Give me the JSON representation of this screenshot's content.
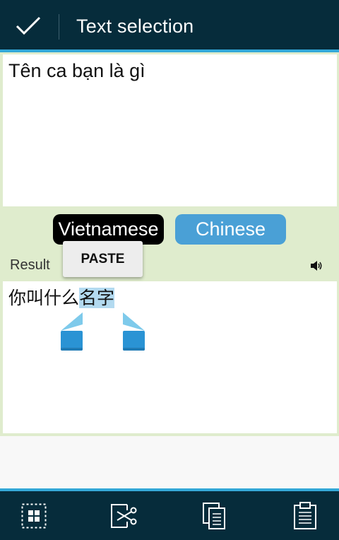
{
  "action_bar": {
    "title": "Text selection",
    "done_icon": "check-icon"
  },
  "input": {
    "text": "Tên ca bạn là gì"
  },
  "languages": {
    "source": "Vietnamese",
    "target": "Chinese"
  },
  "result": {
    "label": "Result",
    "text_plain": "你叫什么",
    "text_selected": "名字",
    "speaker_icon": "speaker-icon"
  },
  "context_popup": {
    "paste_label": "PASTE"
  },
  "bottom_bar": {
    "items": [
      {
        "icon": "select-all-icon"
      },
      {
        "icon": "cut-icon"
      },
      {
        "icon": "copy-icon"
      },
      {
        "icon": "paste-icon"
      }
    ]
  },
  "colors": {
    "bar_background": "#062c3b",
    "accent": "#33a8d8",
    "page_background": "#dfeccd",
    "selection": "#b3daf0",
    "target_button": "#4aa0d6"
  }
}
